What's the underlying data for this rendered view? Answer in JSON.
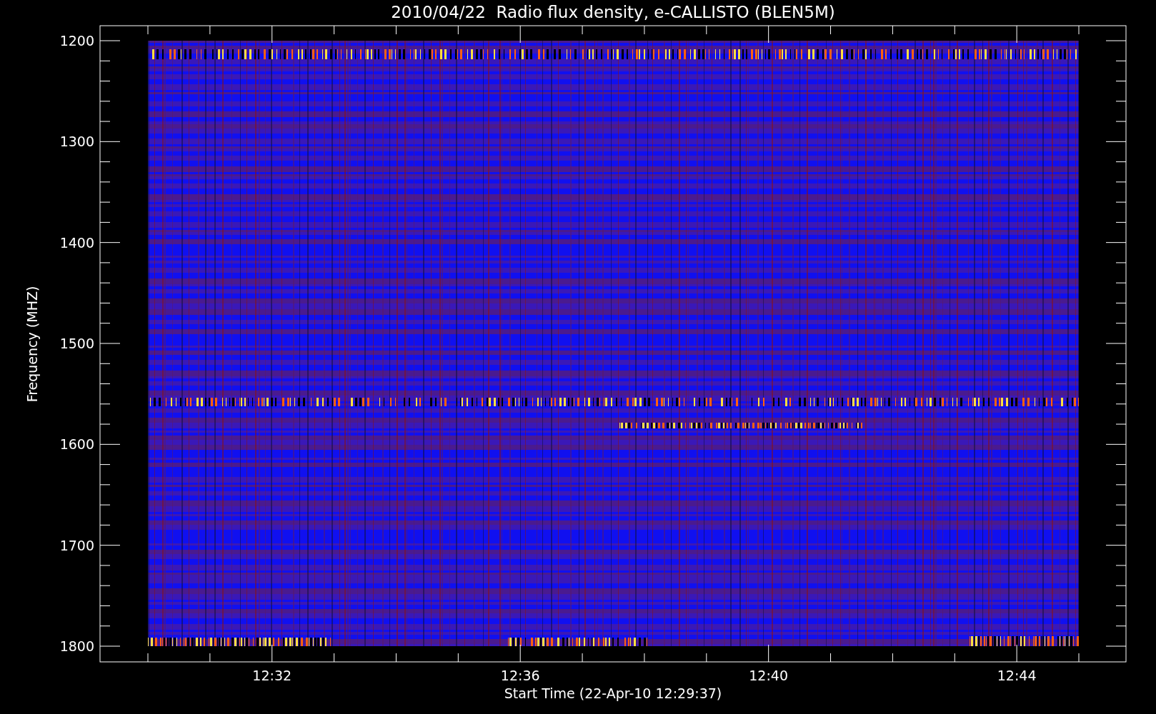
{
  "title": "2010/04/22  Radio flux density, e-CALLISTO (BLEN5M)",
  "y_axis": {
    "label": "Frequency (MHZ)",
    "ticks": [
      "1200",
      "1300",
      "1400",
      "1500",
      "1600",
      "1700",
      "1800"
    ]
  },
  "x_axis": {
    "label": "Start Time (22-Apr-10 12:29:37)",
    "ticks": [
      "12:32",
      "12:36",
      "12:40",
      "12:44"
    ]
  }
}
